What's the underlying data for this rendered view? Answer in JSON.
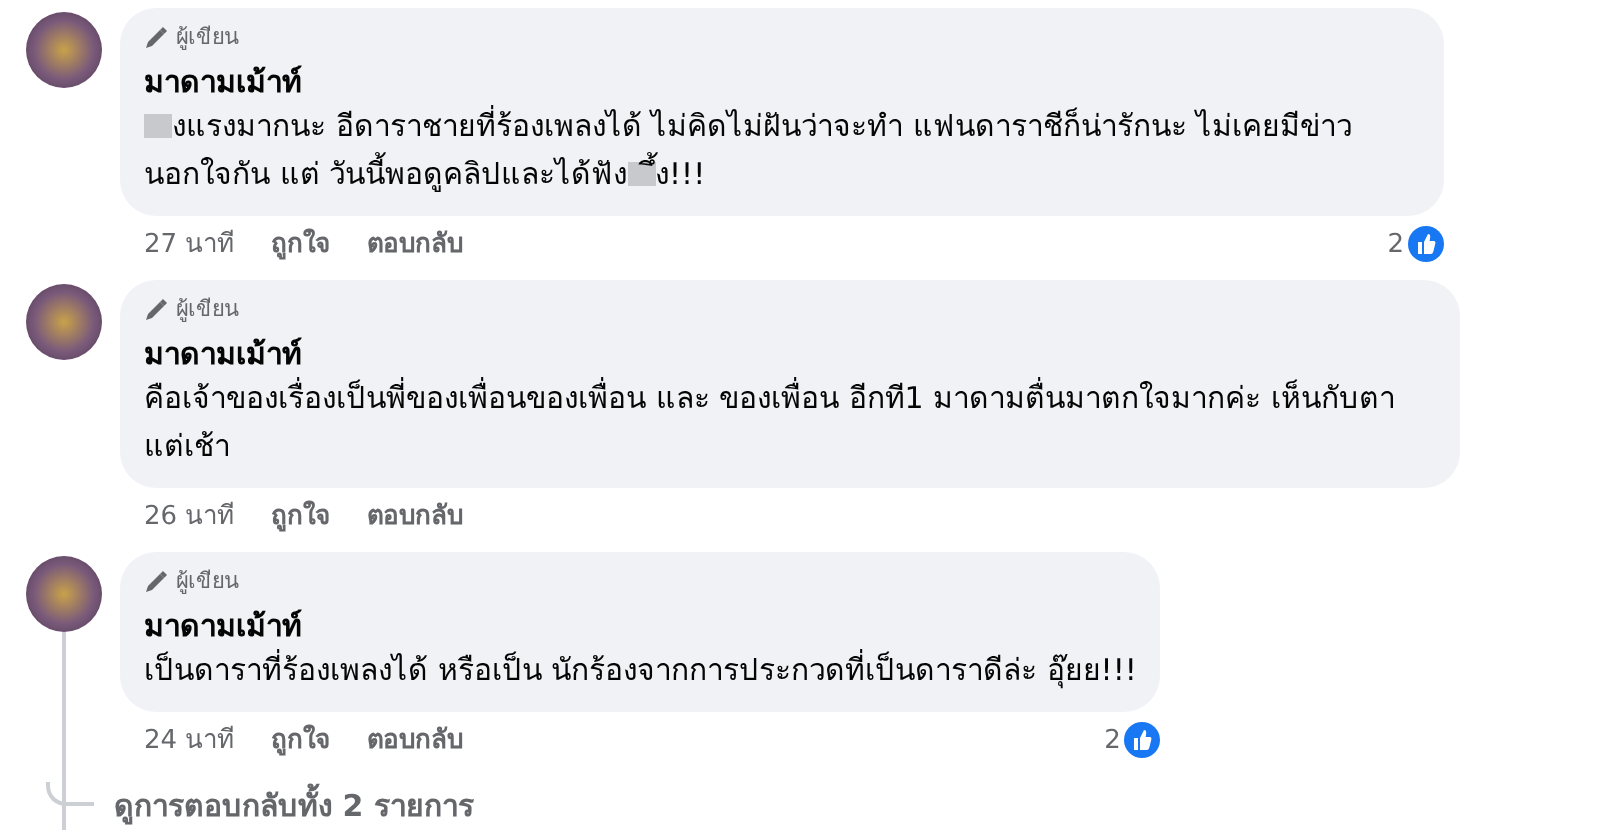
{
  "comments": [
    {
      "badge": "ผู้เขียน",
      "author": "มาดามเม้าท์",
      "message": [
        {
          "kind": "redacted"
        },
        {
          "kind": "text",
          "text": "งแรงมากนะ อีดาราชายที่ร้องเพลงได้ ไม่คิดไม่ฝันว่าจะทำ แฟนดาราชีก็น่ารักนะ ไม่เคยมีข่าว นอกใจกัน แต่ วันนี้พอดูคลิปและได้ฟัง"
        },
        {
          "kind": "redacted"
        },
        {
          "kind": "text",
          "text": "ึ้ง!!!"
        }
      ],
      "time": "27 นาที",
      "like": "ถูกใจ",
      "reply": "ตอบกลับ",
      "reaction_count": "2"
    },
    {
      "badge": "ผู้เขียน",
      "author": "มาดามเม้าท์",
      "message": [
        {
          "kind": "text",
          "text": "คือเจ้าของเรื่องเป็นพี่ของเพื่อนของเพื่อน และ ของเพื่อน อีกที1 มาดามตื่นมาตกใจมากค่ะ เห็นกับตา แต่เช้า"
        }
      ],
      "time": "26 นาที",
      "like": "ถูกใจ",
      "reply": "ตอบกลับ"
    },
    {
      "badge": "ผู้เขียน",
      "author": "มาดามเม้าท์",
      "message": [
        {
          "kind": "text",
          "text": "เป็นดาราที่ร้องเพลงได้ หรือเป็น นักร้องจากการประกวดที่เป็นดาราดีล่ะ อุ๊ยย!!!"
        }
      ],
      "time": "24 นาที",
      "like": "ถูกใจ",
      "reply": "ตอบกลับ",
      "reaction_count": "2",
      "replies_link": "ดูการตอบกลับทั้ง 2 รายการ"
    }
  ]
}
